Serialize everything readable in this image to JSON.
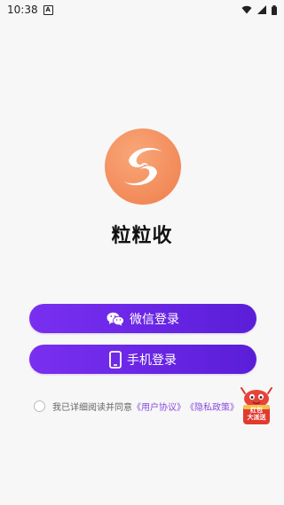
{
  "status_bar": {
    "time": "10:38",
    "notification_icon": "A"
  },
  "app": {
    "title": "粒粒收"
  },
  "buttons": {
    "wechat_login": "微信登录",
    "phone_login": "手机登录"
  },
  "agreement": {
    "prefix": "我已详细阅读并同意",
    "user_agreement": "《用户协议》",
    "privacy_policy": "《隐私政策》"
  },
  "promo": {
    "label_line1": "红包",
    "label_line2": "大派送"
  },
  "colors": {
    "accent": "#6a26e6",
    "logo": "#f28a59",
    "link": "#8a4be0"
  }
}
